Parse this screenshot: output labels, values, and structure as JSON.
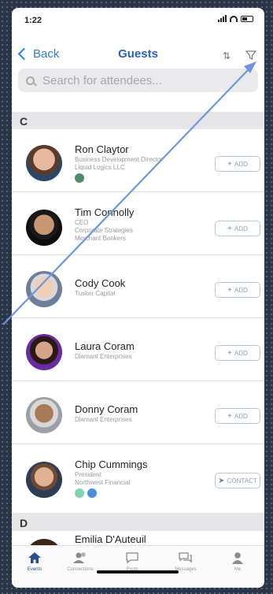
{
  "status": {
    "time": "1:22"
  },
  "nav": {
    "back_label": "Back",
    "title": "Guests"
  },
  "search": {
    "placeholder": "Search for attendees..."
  },
  "sections": [
    "C",
    "D"
  ],
  "guests": [
    {
      "name": "Ron Claytor",
      "lines": [
        "Business Development Director",
        "Liquid Logics LLC"
      ],
      "dots": [
        "#4e8c6b"
      ],
      "button": "ADD"
    },
    {
      "name": "Tim Connolly",
      "lines": [
        "CEO",
        "Corporate Strategies",
        "Merchant Bankers"
      ],
      "dots": [],
      "button": "ADD"
    },
    {
      "name": "Cody Cook",
      "lines": [
        "Tusker Capital"
      ],
      "dots": [],
      "button": "ADD"
    },
    {
      "name": "Laura Coram",
      "lines": [
        "Diamant Enterprises"
      ],
      "dots": [],
      "button": "ADD"
    },
    {
      "name": "Donny Coram",
      "lines": [
        "Diamant Enterprises"
      ],
      "dots": [],
      "button": "ADD"
    },
    {
      "name": "Chip Cummings",
      "lines": [
        "President",
        "Northwest Financial"
      ],
      "dots": [
        "#7fd3b8",
        "#4a90d9"
      ],
      "button": "CONTACT"
    },
    {
      "name": "Emilia D'Auteuil",
      "lines": [],
      "dots": [],
      "button": ""
    }
  ],
  "tabs": [
    {
      "label": "Events",
      "icon": "home-icon"
    },
    {
      "label": "Connections",
      "icon": "people-icon"
    },
    {
      "label": "Posts",
      "icon": "chat-icon"
    },
    {
      "label": "Messages",
      "icon": "messages-icon"
    },
    {
      "label": "Me",
      "icon": "person-icon"
    }
  ],
  "colors": {
    "accent": "#2f7ce0",
    "annotation": "#6f95e0"
  }
}
